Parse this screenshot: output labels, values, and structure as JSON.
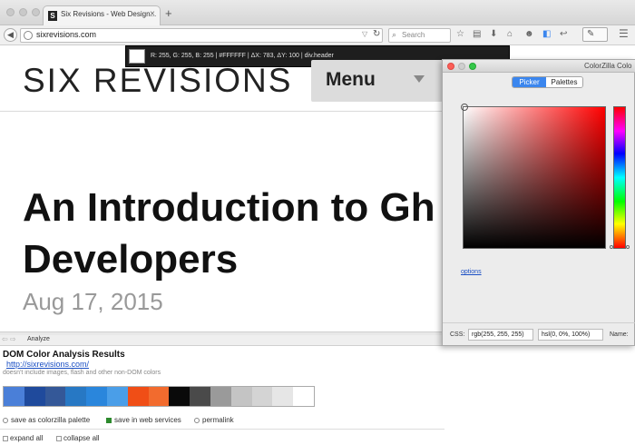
{
  "browser": {
    "tab": {
      "favicon": "S",
      "title": "Six Revisions - Web Design...",
      "close": "×"
    },
    "new_tab": "+",
    "url": "sixrevisions.com",
    "url_dropdown": "▽",
    "reload": "↻",
    "search_placeholder": "Search",
    "toolbar_icons": [
      "star-icon",
      "clipboard-icon",
      "download-icon",
      "home-icon",
      "chat-icon",
      "extension-icon",
      "dropper-icon",
      "menu-icon"
    ]
  },
  "colorzilla_status": {
    "swatch_color": "#FFFFFF",
    "text": "R: 255, G: 255, B: 255 | #FFFFFF | ΔX: 783, ΔY: 100 | div.header"
  },
  "page": {
    "logo": "SIX REVISIONS",
    "menu_label": "Menu",
    "title_line1": "An Introduction to Gh",
    "title_line2": "Developers",
    "date": "Aug 17, 2015"
  },
  "analysis": {
    "toolbar_label": "Analyze",
    "title": "DOM Color Analysis Results",
    "url": "http://sixrevisions.com/",
    "note": "doesn't include images, flash and other non-DOM colors",
    "swatches": [
      "#4a7fd8",
      "#1f4a9c",
      "#345898",
      "#2778c4",
      "#2a86dc",
      "#4a9ee8",
      "#f04e16",
      "#f26b2e",
      "#0a0a0a",
      "#4a4a4a",
      "#9a9a9a",
      "#c4c4c4",
      "#d4d4d4",
      "#e6e6e6",
      "#ffffff"
    ],
    "save_palette": "save as colorzilla palette",
    "save_web": "save in web services",
    "permalink": "permalink",
    "expand_all": "expand all",
    "collapse_all": "collapse all"
  },
  "picker": {
    "window_title": "ColorZilla Colo",
    "tab_picker": "Picker",
    "tab_palettes": "Palettes",
    "options": "options",
    "css_label": "CSS:",
    "css_value": "rgb(255, 255, 255)",
    "hsl_value": "hsl(0, 0%, 100%)",
    "name_label": "Name:"
  },
  "colors": {
    "accent": "#3b86ee",
    "link": "#1a4fc4"
  }
}
